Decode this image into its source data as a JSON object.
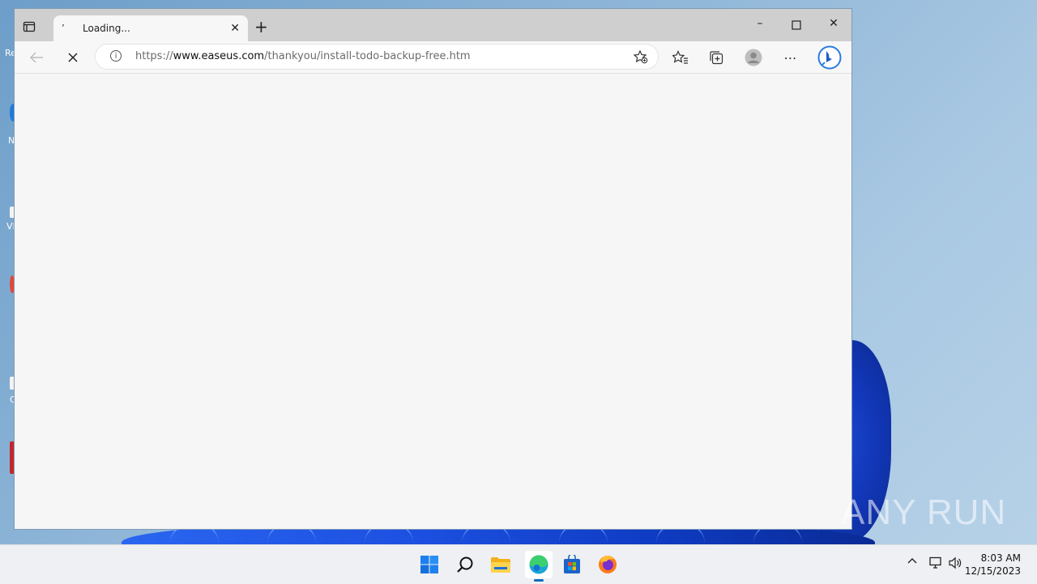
{
  "desktop": {
    "fragments": [
      "Re",
      "N",
      "VL",
      "C"
    ]
  },
  "browser": {
    "tab": {
      "title": "Loading...",
      "close_icon": "close-icon"
    },
    "address_bar": {
      "scheme": "https://",
      "host": "www.easeus.com",
      "path": "/thankyou/install-todo-backup-free.htm"
    },
    "colors": {
      "accent": "#0f6cbd",
      "tabbar": "#cfcfcf",
      "content": "#f6f6f6"
    }
  },
  "taskbar": {
    "apps": [
      "start-icon",
      "search-icon",
      "file-explorer-icon",
      "edge-icon",
      "store-icon",
      "firefox-icon"
    ],
    "clock": {
      "time": "8:03 AM",
      "date": "12/15/2023"
    }
  },
  "watermark": "ANY RUN"
}
